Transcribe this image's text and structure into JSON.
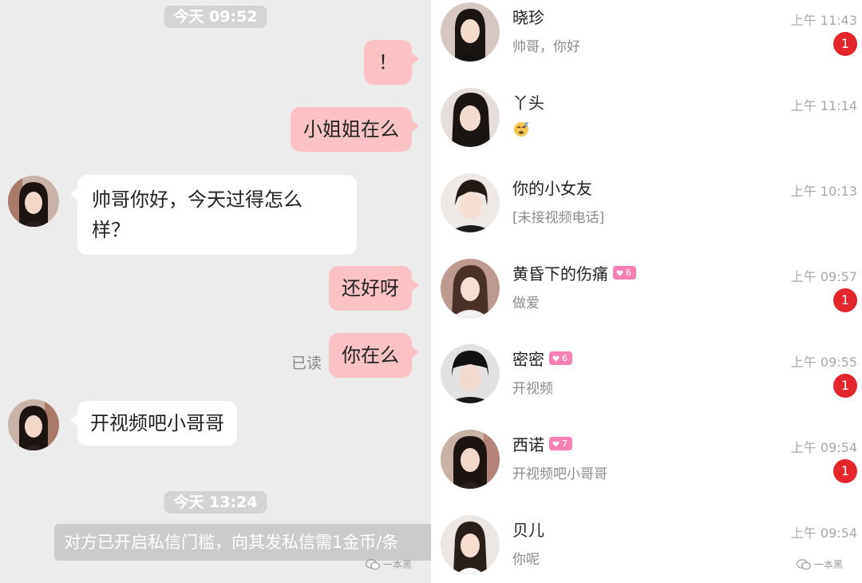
{
  "chat": {
    "timestamps": [
      "今天 09:52",
      "今天 13:24"
    ],
    "messages": [
      {
        "dir": "out",
        "text": "！"
      },
      {
        "dir": "out",
        "text": "小姐姐在么"
      },
      {
        "dir": "in",
        "text_line1": "帅哥你好，今天过得怎么",
        "text_line2": "样？"
      },
      {
        "dir": "out",
        "text": "还好呀"
      },
      {
        "dir": "out",
        "text": "你在么",
        "status": "已读"
      },
      {
        "dir": "in",
        "text": "开视频吧小哥哥"
      }
    ],
    "notice": "对方已开启私信门槛，向其发私信需1金币/条",
    "watermark": "一本黑"
  },
  "list": {
    "conversations": [
      {
        "name": "晓珍",
        "preview": "帅哥，你好",
        "time": "上午 11:43",
        "unread": "1"
      },
      {
        "name": "丫头",
        "preview_icon": "sleepy-emoji-icon",
        "time": "上午 11:14"
      },
      {
        "name": "你的小女友",
        "preview": "[未接视频电话]",
        "time": "上午 10:13"
      },
      {
        "name": "黄昏下的伤痛",
        "level": "6",
        "preview": "做爱",
        "time": "上午 09:57",
        "unread": "1"
      },
      {
        "name": "密密",
        "level": "6",
        "preview": "开视频",
        "time": "上午 09:55",
        "unread": "1"
      },
      {
        "name": "西诺",
        "level": "7",
        "preview": "开视频吧小哥哥",
        "time": "上午 09:54",
        "unread": "1"
      },
      {
        "name": "贝儿",
        "preview": "你呢",
        "time": "上午 09:54"
      }
    ],
    "watermark": "一本黑"
  },
  "colors": {
    "outgoing_bubble": "#fbc2c6",
    "incoming_bubble": "#ffffff",
    "chat_background": "#ececec",
    "unread_badge": "#e4262b",
    "level_badge": "#f77fb3",
    "preview_pink": "#e0507f"
  }
}
